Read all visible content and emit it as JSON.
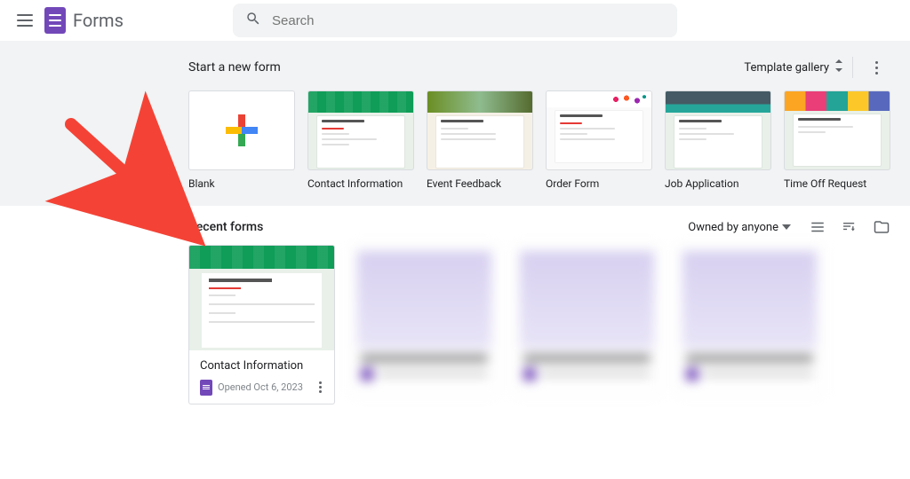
{
  "header": {
    "app_name": "Forms",
    "search_placeholder": "Search"
  },
  "templates": {
    "section_title": "Start a new form",
    "gallery_label": "Template gallery",
    "items": [
      {
        "label": "Blank"
      },
      {
        "label": "Contact Information"
      },
      {
        "label": "Event Feedback"
      },
      {
        "label": "Order Form"
      },
      {
        "label": "Job Application"
      },
      {
        "label": "Time Off Request"
      }
    ]
  },
  "recent": {
    "section_title": "Recent forms",
    "filter_label": "Owned by anyone",
    "docs": [
      {
        "title": "Contact Information",
        "opened": "Opened Oct 6, 2023"
      }
    ]
  },
  "colors": {
    "brand": "#7248b9",
    "accent_green": "#0f9d58"
  }
}
